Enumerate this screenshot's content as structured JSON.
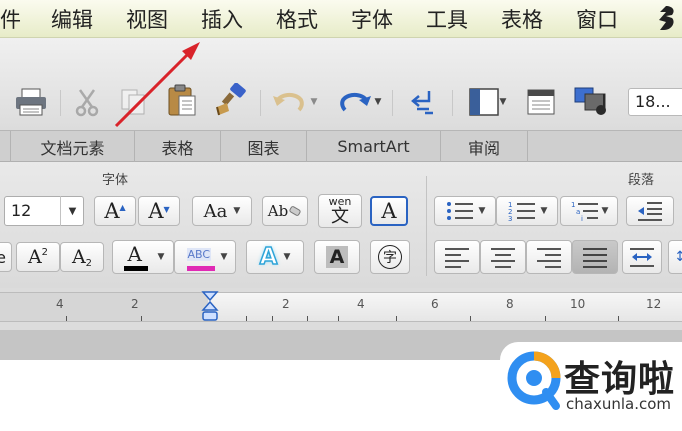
{
  "menubar": {
    "items": [
      "件",
      "编辑",
      "视图",
      "插入",
      "格式",
      "字体",
      "工具",
      "表格",
      "窗口"
    ]
  },
  "toolbar": {
    "zoom_value": "18..."
  },
  "tabs": [
    "文档元素",
    "表格",
    "图表",
    "SmartArt",
    "审阅"
  ],
  "ribbon": {
    "font_group_label": "字体",
    "paragraph_group_label": "段落",
    "font_size_value": "12",
    "grow_font_label": "A",
    "shrink_font_label": "A",
    "change_case_label": "Aa",
    "spelling_label": "Ab",
    "phonetic_top": "wen",
    "phonetic_bottom": "文",
    "text_box_label": "A",
    "superscript_base": "A",
    "superscript_mark": "2",
    "subscript_base": "A",
    "subscript_mark": "2",
    "font_color_label": "A",
    "highlight_label": "ABC",
    "text_effects_label": "A",
    "char_shading_label": "A",
    "enclosed_char_label": "字"
  },
  "ruler": {
    "labels": [
      "4",
      "2",
      "2",
      "4",
      "6",
      "8",
      "10",
      "12"
    ]
  },
  "watermark": {
    "name": "查询啦",
    "url": "chaxunla.com"
  },
  "colors": {
    "menubar_bg": "#eef1d6",
    "arrow": "#d9232a",
    "font_color_bar": "#000000",
    "highlight_bar": "#e02ab4",
    "logo_blue": "#2f8ef1",
    "logo_orange": "#f4a21c"
  }
}
